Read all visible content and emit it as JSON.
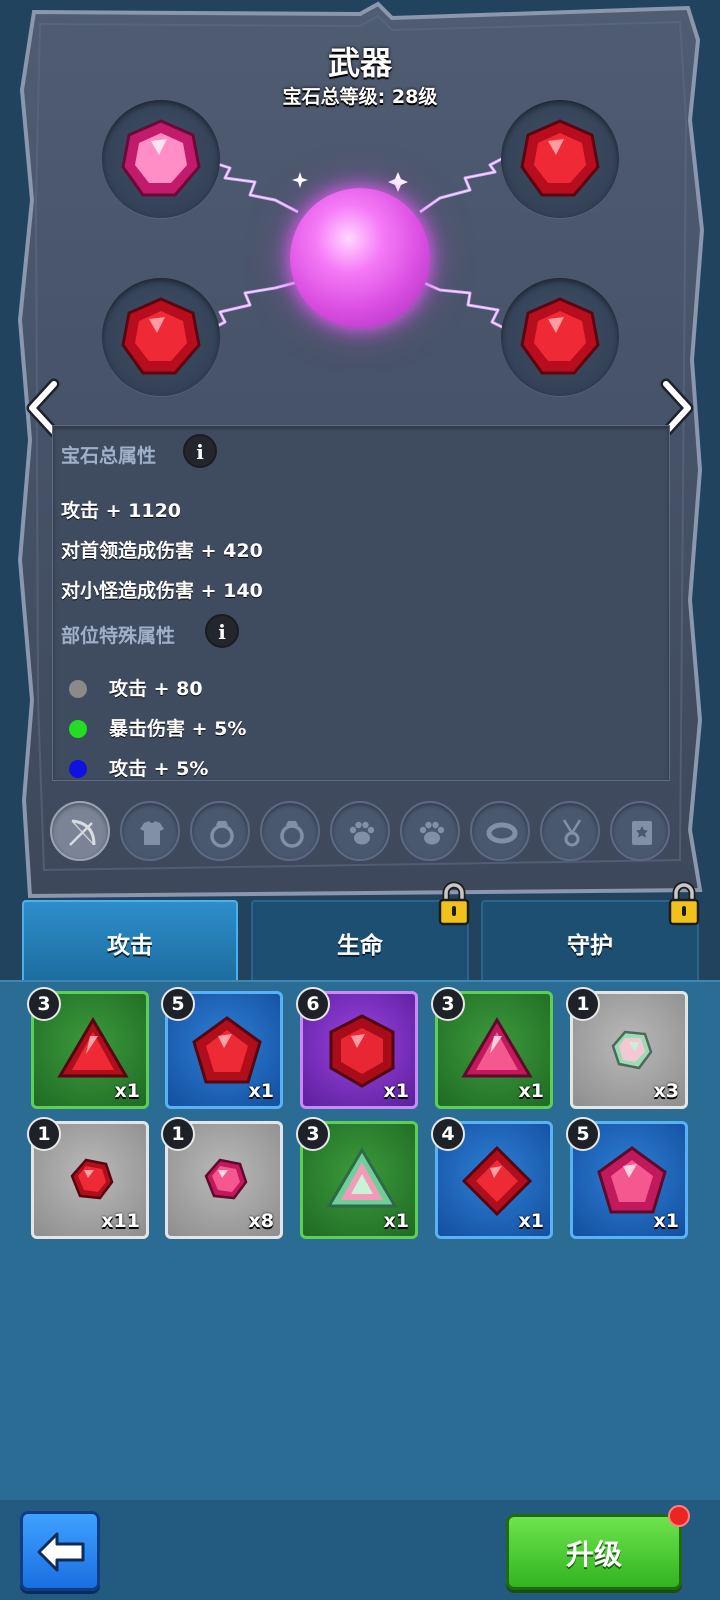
{
  "header": {
    "title": "武器",
    "subtitle": "宝石总等级: 28级"
  },
  "gem_sockets": [
    {
      "position": "top-left",
      "gem": "pink"
    },
    {
      "position": "top-right",
      "gem": "red"
    },
    {
      "position": "bottom-left",
      "gem": "red"
    },
    {
      "position": "bottom-right",
      "gem": "red"
    }
  ],
  "stats": {
    "total_title": "宝石总属性",
    "info_glyph": "i",
    "total_lines": [
      "攻击 + 1120",
      "对首领造成伤害 + 420",
      "对小怪造成伤害 + 140"
    ],
    "special_title": "部位特殊属性",
    "special_lines": [
      {
        "color": "#8a8a8a",
        "text": "攻击 + 80"
      },
      {
        "color": "#22dd22",
        "text": "暴击伤害 + 5%"
      },
      {
        "color": "#1010e0",
        "text": "攻击 + 5%"
      }
    ]
  },
  "equipment_slots": [
    {
      "icon": "bow-icon",
      "active": true
    },
    {
      "icon": "armor-icon",
      "active": false
    },
    {
      "icon": "ring-icon",
      "active": false
    },
    {
      "icon": "ring-icon",
      "active": false
    },
    {
      "icon": "paw-icon",
      "active": false
    },
    {
      "icon": "paw-icon",
      "active": false
    },
    {
      "icon": "bracelet-icon",
      "active": false
    },
    {
      "icon": "necklace-icon",
      "active": false
    },
    {
      "icon": "book-icon",
      "active": false
    }
  ],
  "tabs": [
    {
      "label": "攻击",
      "active": true,
      "locked": false
    },
    {
      "label": "生命",
      "active": false,
      "locked": true
    },
    {
      "label": "守护",
      "active": false,
      "locked": true
    }
  ],
  "inventory": [
    {
      "level": "3",
      "count": "x1",
      "rarity": "green",
      "gem": "red-triangle"
    },
    {
      "level": "5",
      "count": "x1",
      "rarity": "blue",
      "gem": "red-pentagon"
    },
    {
      "level": "6",
      "count": "x1",
      "rarity": "purple",
      "gem": "red-hexagon"
    },
    {
      "level": "3",
      "count": "x1",
      "rarity": "green",
      "gem": "pink-triangle"
    },
    {
      "level": "1",
      "count": "x3",
      "rarity": "gray",
      "gem": "rainbow-small"
    },
    {
      "level": "1",
      "count": "x11",
      "rarity": "gray",
      "gem": "red-small"
    },
    {
      "level": "1",
      "count": "x8",
      "rarity": "gray",
      "gem": "pink-small"
    },
    {
      "level": "3",
      "count": "x1",
      "rarity": "green",
      "gem": "rainbow-triangle"
    },
    {
      "level": "4",
      "count": "x1",
      "rarity": "blue",
      "gem": "red-diamond"
    },
    {
      "level": "5",
      "count": "x1",
      "rarity": "blue",
      "gem": "pink-pentagon"
    }
  ],
  "footer": {
    "back_icon": "back-arrow-icon",
    "upgrade_label": "升级"
  }
}
